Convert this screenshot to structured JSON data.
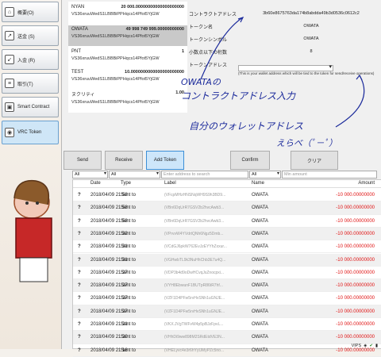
{
  "sidebar": {
    "items": [
      {
        "label": "概要(O)",
        "icon": "home-icon"
      },
      {
        "label": "送金 (S)",
        "icon": "send-icon"
      },
      {
        "label": "入金 (R)",
        "icon": "receive-icon"
      },
      {
        "label": "取引(T)",
        "icon": "transactions-icon"
      },
      {
        "label": "Smart Contract",
        "icon": "contract-icon"
      },
      {
        "label": "VRC Token",
        "icon": "token-icon"
      }
    ]
  },
  "tokens": [
    {
      "name": "NYAN",
      "balance": "20 000.00000000000000000000",
      "address": "VS36xruuWedS1LBBBiPPHqcs14Pfot5YjGW"
    },
    {
      "name": "OWATA",
      "balance": "49 998 749 999.00000000000",
      "address": "VS36xruuWedS1LBBBiPPHqcs14Pfot5YjGW"
    },
    {
      "name": "PNT",
      "balance": "1",
      "address": "VS36xruuWedS1LBBBiPPHqcs14Pfot5YjGW"
    },
    {
      "name": "TEST",
      "balance": "10.0000000000000000000000",
      "address": "VS36xruuWedS1LBBBiPPHqcs14Pfot5YjGW"
    },
    {
      "name": "ヌクリティ",
      "balance": "1.00",
      "address": "VS36xruuWedS1LBBBiPPHqcs14Pfot5YjGW"
    }
  ],
  "form": {
    "contract_label": "コントラクトアドレス",
    "contract_value": "3b60e8675763da174b8abdda49b3d0536c0612c2",
    "name_label": "トークン名",
    "name_value": "OWATA",
    "symbol_label": "トークンシンボル",
    "symbol_value": "OWATA",
    "decimals_label": "小数点以下の桁数",
    "decimals_value": "8",
    "address_label": "トークンアドレス",
    "note": "(This is your wallet address which will be tied to the token for send/receive operations)"
  },
  "annotations": {
    "line1": "OWATAの",
    "line2": "コントラクトアドレス入力",
    "line3": "自分のウォレットアドレス",
    "line4": "えらべ（ﾟ－ﾟ）"
  },
  "buttons": {
    "send": "Send",
    "receive": "Receive",
    "add_token": "Add Token",
    "confirm": "Confirm",
    "clear": "クリア"
  },
  "filters": {
    "date": "All",
    "type": "All",
    "address_placeholder": "Enter address to search",
    "name": "All",
    "amount_placeholder": "Min amount"
  },
  "table": {
    "headers": [
      "Date",
      "Type",
      "Label",
      "Name",
      "Amount"
    ],
    "rows": [
      {
        "date": "2018/04/09 21:58",
        "type": "Sent to",
        "label": "(VFcpMHzHNSNqWH9S9h3BD9...",
        "name": "OWATA",
        "amount": "-10 000.00000000"
      },
      {
        "date": "2018/04/09 21:58",
        "type": "Sent to",
        "label": "(VBn6DqUrR7GSV2b2hvcAwb3...",
        "name": "OWATA",
        "amount": "-10 000.00000000"
      },
      {
        "date": "2018/04/09 21:58",
        "type": "Sent to",
        "label": "(VBn6DqUrR7GSV2b2hvcAwb3...",
        "name": "OWATA",
        "amount": "-10 000.00000000"
      },
      {
        "date": "2018/04/09 21:32",
        "type": "Sent to",
        "label": "(VPrvvW4YVdrtQNh6Ngz5Dmb...",
        "name": "OWATA",
        "amount": "-10 000.00000000"
      },
      {
        "date": "2018/04/09 21:31",
        "type": "Sent to",
        "label": "(VCdGJ6pkW762EvJzEYYhZxxur...",
        "name": "OWATA",
        "amount": "-10 000.00000000"
      },
      {
        "date": "2018/04/09 21:31",
        "type": "Sent to",
        "label": "(VGHwbTL9k3NuHhChb3E7u4Q...",
        "name": "OWATA",
        "amount": "-10 000.00000000"
      },
      {
        "date": "2018/04/09 21:27",
        "type": "Sent to",
        "label": "(VDP3b4d9oDwHCvqJsZnocpxi...",
        "name": "OWATA",
        "amount": "-10 000.00000000"
      },
      {
        "date": "2018/04/09 21:27",
        "type": "Sent to",
        "label": "(VYH8EbwunF1BUTpR86tR7hf...",
        "name": "OWATA",
        "amount": "-10 000.00000000"
      },
      {
        "date": "2018/04/09 21:27",
        "type": "Sent to",
        "label": "(VZF1D4PFw5rvHvSNh1uGNJE...",
        "name": "OWATA",
        "amount": "-10 000.00000000"
      },
      {
        "date": "2018/04/09 21:27",
        "type": "Sent to",
        "label": "(VZF1D4PFw5rvHvSNh1uGNJE...",
        "name": "OWATA",
        "amount": "-10 000.00000000"
      },
      {
        "date": "2018/04/09 21:21",
        "type": "Sent to",
        "label": "(VKX.JVgTWFvW4p5pBJzFpvL...",
        "name": "OWATA",
        "amount": "-10 000.00000000"
      },
      {
        "date": "2018/04/09 21:20",
        "type": "Sent to",
        "label": "(VHhDi9ww898M2SRdEtdVE3N...",
        "name": "OWATA",
        "amount": "-10 000.00000000"
      },
      {
        "date": "2018/04/09 21:16",
        "type": "Sent to",
        "label": "(VHELyvc4e3r6hYyUMyPZc5no...",
        "name": "OWATA",
        "amount": "-10 000.00000000"
      }
    ]
  },
  "status": {
    "network": "VIPS",
    "icons": [
      "staking-icon",
      "sync-check-icon",
      "network-icon"
    ]
  }
}
